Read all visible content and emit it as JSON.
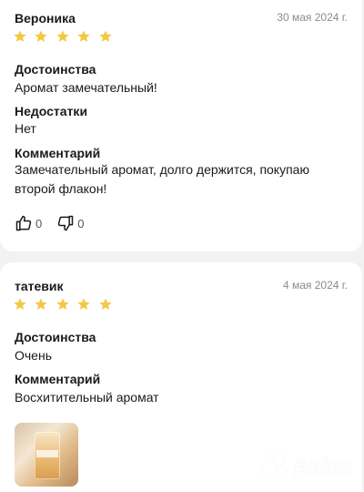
{
  "reviews": [
    {
      "author": "Вероника",
      "date": "30 мая 2024 г.",
      "rating": 5,
      "sections": [
        {
          "title": "Достоинства",
          "text": "Аромат замечательный!"
        },
        {
          "title": "Недостатки",
          "text": "Нет"
        },
        {
          "title": "Комментарий",
          "text": "Замечательный аромат, долго держится, покупаю второй флакон!"
        }
      ],
      "likes": "0",
      "dislikes": "0"
    },
    {
      "author": "татевик",
      "date": "4 мая 2024 г.",
      "rating": 5,
      "sections": [
        {
          "title": "Достоинства",
          "text": "Очень"
        },
        {
          "title": "Комментарий",
          "text": "Восхитительный аромат"
        }
      ]
    }
  ],
  "watermark": "Avito",
  "colors": {
    "star": "#f5c842",
    "background": "#f2f2f2",
    "card": "#ffffff",
    "date": "#8a8a8a"
  },
  "icons": [
    "star-icon",
    "thumbs-up-icon",
    "thumbs-down-icon",
    "avito-logo"
  ]
}
